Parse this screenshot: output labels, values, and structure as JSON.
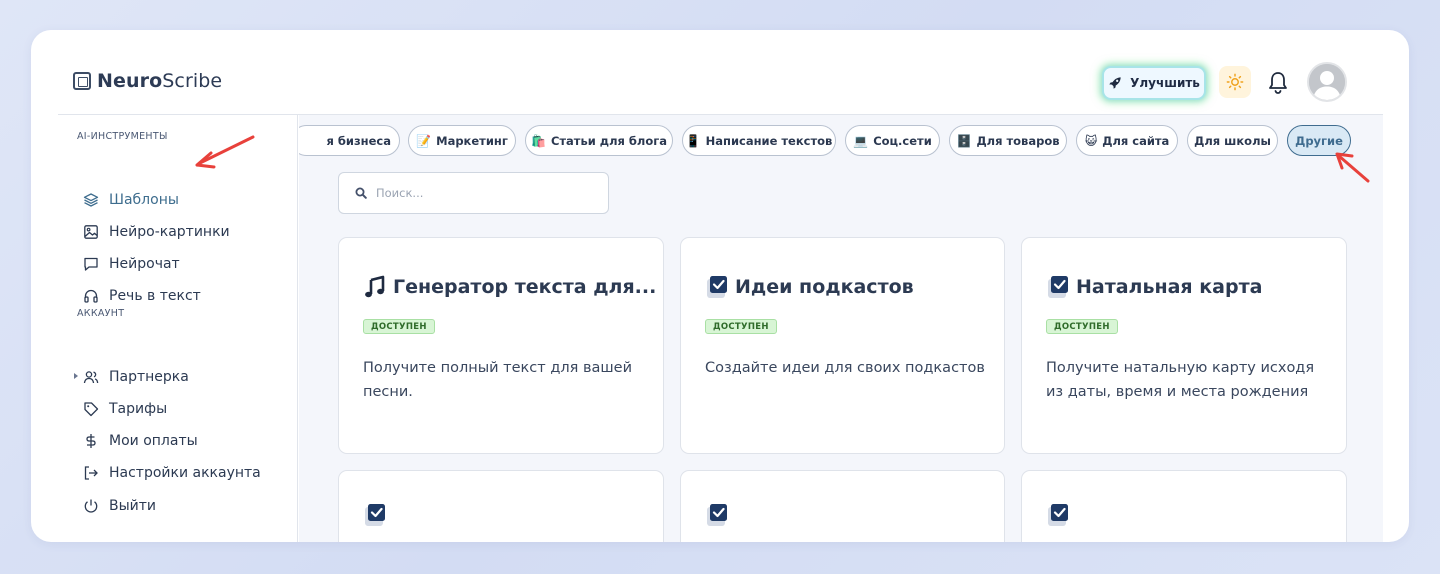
{
  "brand": {
    "name_bold": "Neuro",
    "name_rest": "Scribe"
  },
  "header": {
    "upgrade_label": "Улучшить"
  },
  "sidebar": {
    "section_tools": "AI-ИНСТРУМЕНТЫ",
    "section_account": "АККАУНТ",
    "tools": [
      {
        "label": "Шаблоны",
        "icon": "layers-icon",
        "active": true
      },
      {
        "label": "Нейро-картинки",
        "icon": "image-icon"
      },
      {
        "label": "Нейрочат",
        "icon": "chat-icon"
      },
      {
        "label": "Речь в текст",
        "icon": "headphones-icon"
      }
    ],
    "account": [
      {
        "label": "Партнерка",
        "icon": "users-icon"
      },
      {
        "label": "Тарифы",
        "icon": "tag-icon"
      },
      {
        "label": "Мои оплаты",
        "icon": "dollar-icon"
      },
      {
        "label": "Настройки аккаунта",
        "icon": "logout-arrow-icon"
      },
      {
        "label": "Выйти",
        "icon": "power-icon"
      }
    ]
  },
  "categories": [
    {
      "label": "я бизнеса",
      "emoji": ""
    },
    {
      "label": "Маркетинг",
      "emoji": "📝"
    },
    {
      "label": "Статьи для блога",
      "emoji": "🛍️"
    },
    {
      "label": "Написание текстов",
      "emoji": "📱"
    },
    {
      "label": "Соц.сети",
      "emoji": "💻"
    },
    {
      "label": "Для товаров",
      "emoji": "🗄️"
    },
    {
      "label": "Для сайта",
      "emoji": "😺"
    },
    {
      "label": "Для школы",
      "emoji": ""
    },
    {
      "label": "Другие",
      "emoji": "",
      "selected": true
    }
  ],
  "search": {
    "placeholder": "Поиск..."
  },
  "cards": [
    {
      "title": "Генератор текста для...",
      "badge": "ДОСТУПЕН",
      "desc": "Получите полный текст для вашей песни.",
      "icon": "music-note-icon"
    },
    {
      "title": "Идеи подкастов",
      "badge": "ДОСТУПЕН",
      "desc": "Создайте идеи для своих подкастов",
      "icon": "checkbox-icon"
    },
    {
      "title": "Натальная карта",
      "badge": "ДОСТУПЕН",
      "desc": "Получите натальную карту исходя из даты, время и места рождения",
      "icon": "checkbox-icon"
    }
  ],
  "colors": {
    "accent": "#3f6c8f",
    "arrow": "#e8413b",
    "badge_bg": "#d8f5d5"
  }
}
